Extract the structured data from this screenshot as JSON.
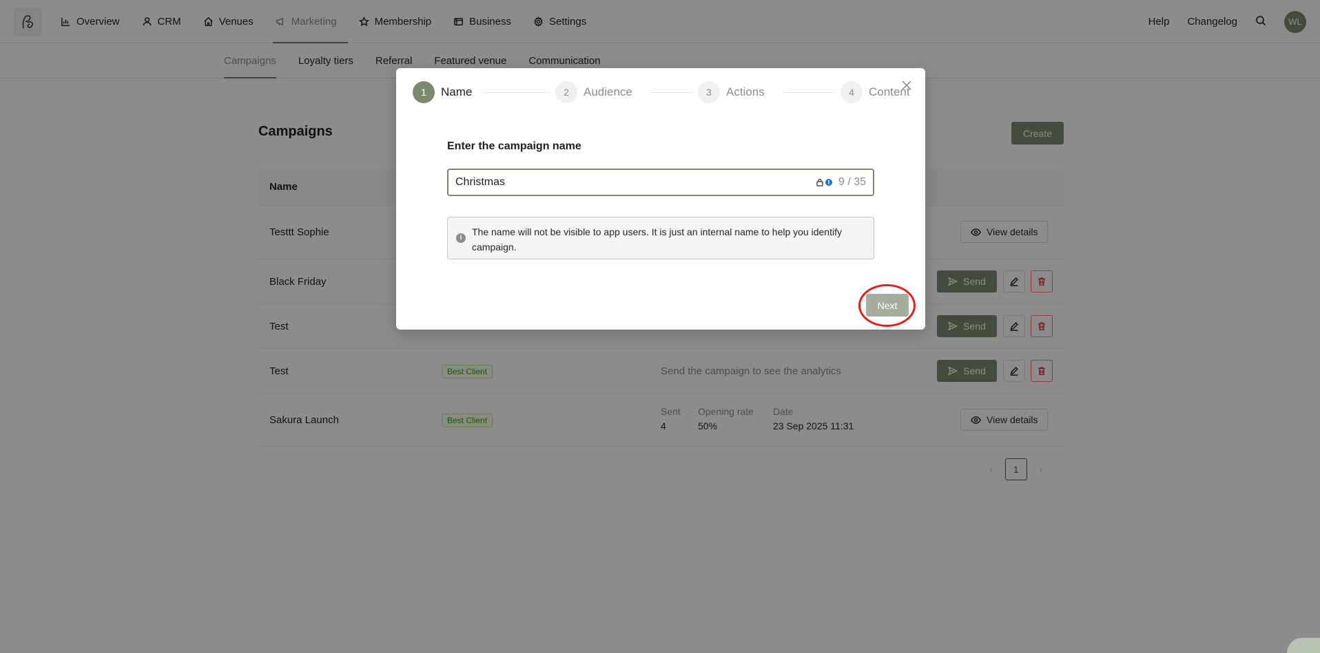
{
  "nav": {
    "items": [
      {
        "label": "Overview",
        "icon": "bar-chart-icon"
      },
      {
        "label": "CRM",
        "icon": "user-icon"
      },
      {
        "label": "Venues",
        "icon": "home-icon"
      },
      {
        "label": "Marketing",
        "icon": "megaphone-icon"
      },
      {
        "label": "Membership",
        "icon": "star-icon"
      },
      {
        "label": "Business",
        "icon": "wallet-icon"
      },
      {
        "label": "Settings",
        "icon": "gear-icon"
      }
    ],
    "active": "Marketing",
    "help": "Help",
    "changelog": "Changelog",
    "avatar": "WL"
  },
  "subnav": {
    "items": [
      "Campaigns",
      "Loyalty tiers",
      "Referral",
      "Featured venue",
      "Communication"
    ],
    "active": "Campaigns"
  },
  "page": {
    "title": "Campaigns",
    "create_label": "Create",
    "table_header_name": "Name",
    "rows": [
      {
        "name": "Testtt Sophie",
        "action": "View details"
      },
      {
        "name": "Black Friday",
        "send": "Send"
      },
      {
        "name": "Test",
        "send": "Send"
      },
      {
        "name": "Test",
        "tag": "Best Client",
        "analytics": "Send the campaign to see the analytics",
        "send": "Send"
      },
      {
        "name": "Sakura Launch",
        "tag": "Best Client",
        "sent_label": "Sent",
        "sent_value": "4",
        "open_label": "Opening rate",
        "open_value": "50%",
        "date_label": "Date",
        "date_value": "23 Sep 2025 11:31",
        "action": "View details"
      }
    ],
    "pagination": {
      "prev": "‹",
      "current": "1",
      "next": "›"
    }
  },
  "modal": {
    "steps": [
      {
        "num": "1",
        "label": "Name"
      },
      {
        "num": "2",
        "label": "Audience"
      },
      {
        "num": "3",
        "label": "Actions"
      },
      {
        "num": "4",
        "label": "Content"
      }
    ],
    "active_step": 1,
    "field_label": "Enter the campaign name",
    "input_value": "Christmas",
    "counter": "9 / 35",
    "info_text": "The name will not be visible to app users. It is just an internal name to help you identify campaign.",
    "next_label": "Next"
  },
  "colors": {
    "accent": "#7a8a6e",
    "highlight": "#e0201a"
  }
}
